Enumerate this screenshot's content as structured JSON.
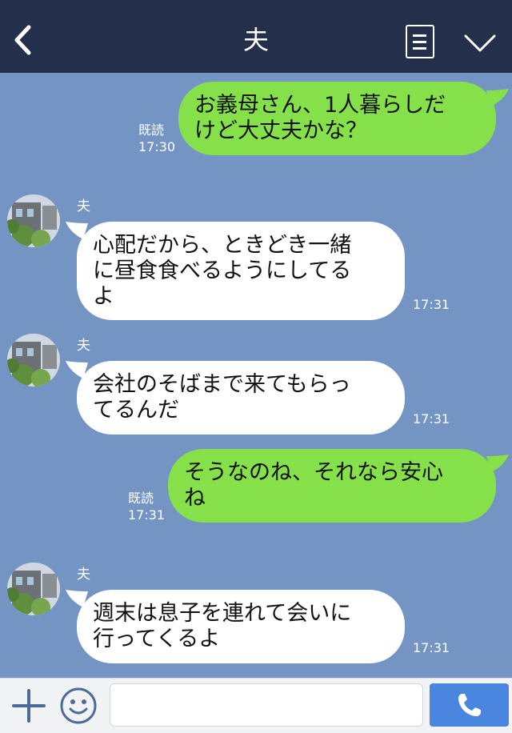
{
  "header": {
    "title": "夫"
  },
  "messages": [
    {
      "direction": "out",
      "text": "お義母さん、1人暮らしだ\nけど大丈夫かな？",
      "read": "既読",
      "time": "17:30"
    },
    {
      "direction": "in",
      "sender": "夫",
      "text": "心配だから、ときどき一緒\nに昼食食べるようにしてる\nよ",
      "time": "17:31"
    },
    {
      "direction": "in",
      "sender": "夫",
      "text": "会社のそばまで来てもらっ\nてるんだ",
      "time": "17:31"
    },
    {
      "direction": "out",
      "text": "そうなのね、それなら安心\nね",
      "read": "既読",
      "time": "17:31"
    },
    {
      "direction": "in",
      "sender": "夫",
      "text": "週末は息子を連れて会いに\n行ってくるよ",
      "time": "17:31"
    }
  ],
  "input": {
    "value": "",
    "placeholder": ""
  },
  "icons": {
    "back": "back-icon",
    "menu": "menu-icon",
    "collapse": "chevron-down-icon",
    "add": "plus-icon",
    "emoji": "emoji-icon",
    "call": "phone-icon"
  },
  "colors": {
    "header_bg": "#232f4b",
    "chat_bg": "#7494c4",
    "outgoing_bubble": "#86e04a",
    "incoming_bubble": "#ffffff",
    "call_button": "#4a86e0"
  }
}
